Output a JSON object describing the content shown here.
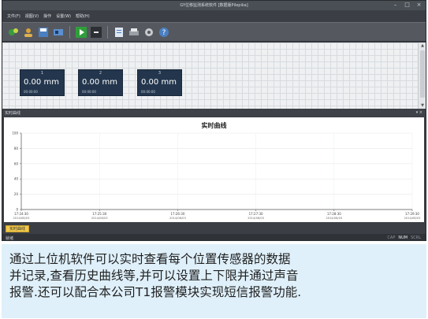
{
  "window": {
    "title": "GY位移监测系统软件 [数据版Pilepika]",
    "controls": [
      "–",
      "□",
      "×"
    ]
  },
  "menu": [
    "文件(F)",
    "视图(V)",
    "操作",
    "设置(W)",
    "帮助(H)"
  ],
  "toolbar": {
    "buttons": [
      {
        "name": "connect-icon",
        "color": "#3a9a3f"
      },
      {
        "name": "user-icon",
        "color": "#d9a33a"
      },
      {
        "name": "save-icon",
        "color": "#4a7fc1"
      },
      {
        "name": "device-icon",
        "color": "#5b8fd0"
      },
      {
        "name": "play-icon",
        "color": "#2f9e3a"
      },
      {
        "name": "stop-icon",
        "color": "#2c2f33"
      },
      {
        "name": "export-icon",
        "color": "#7fa7d9"
      },
      {
        "name": "print-icon",
        "color": "#9aa0a6"
      },
      {
        "name": "settings-icon",
        "color": "#c7cbd0"
      },
      {
        "name": "help-icon",
        "color": "#4a7fc1"
      }
    ]
  },
  "sensors": [
    {
      "number": "1",
      "value": "0.00",
      "unit": "mm",
      "time": "00:00:00"
    },
    {
      "number": "2",
      "value": "0.00",
      "unit": "mm",
      "time": "00:00:00"
    },
    {
      "number": "3",
      "value": "0.00",
      "unit": "mm",
      "time": "00:00:00"
    }
  ],
  "panel": {
    "label": "实时曲线",
    "controls": "▾ ×"
  },
  "chart_data": {
    "type": "line",
    "title": "实时曲线",
    "ylim": [
      0,
      100
    ],
    "yticks": [
      "0",
      "20",
      "40",
      "60",
      "80",
      "100"
    ],
    "x": [
      [
        "17:24:30",
        "2014/08/03"
      ],
      [
        "17:25:30",
        "2014/08/03"
      ],
      [
        "17:26:30",
        "2014/08/03"
      ],
      [
        "17:27:30",
        "2014/08/03"
      ],
      [
        "17:28:30",
        "2014/08/03"
      ],
      [
        "17:29:30",
        "2014/08/03"
      ]
    ],
    "series": [],
    "grid": true
  },
  "tab": {
    "label": "实时曲线"
  },
  "status": {
    "ready": "就绪",
    "indicators": [
      {
        "label": "CAP",
        "on": false
      },
      {
        "label": "NUM",
        "on": true
      },
      {
        "label": "SCRL",
        "on": false
      }
    ]
  },
  "caption": {
    "text": "通过上位机软件可以实时查看每个位置传感器的数据\n并记录,查看历史曲线等,并可以设置上下限并通过声音\n报警.还可以配合本公司T1报警模块实现短信报警功能."
  }
}
